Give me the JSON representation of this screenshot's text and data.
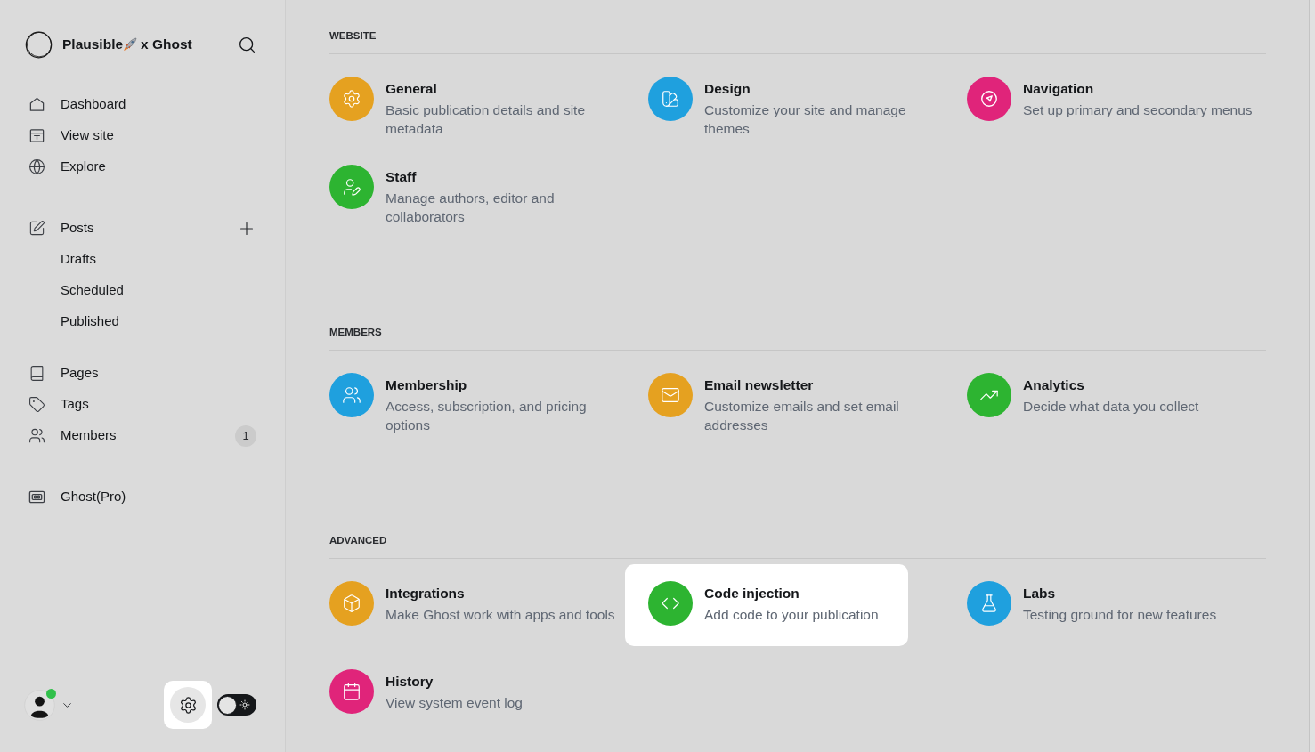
{
  "sidebar": {
    "brand": {
      "name": "Plausible",
      "suffix": "x Ghost"
    },
    "nav_groups": [
      {
        "items": [
          {
            "label": "Dashboard"
          },
          {
            "label": "View site"
          },
          {
            "label": "Explore"
          }
        ]
      },
      {
        "items": [
          {
            "label": "Posts",
            "children": [
              {
                "label": "Drafts"
              },
              {
                "label": "Scheduled"
              },
              {
                "label": "Published"
              }
            ]
          }
        ]
      },
      {
        "items": [
          {
            "label": "Pages"
          },
          {
            "label": "Tags"
          },
          {
            "label": "Members",
            "count": "1"
          }
        ]
      },
      {
        "items": [
          {
            "label": "Ghost(Pro)"
          }
        ]
      }
    ],
    "user": {
      "online": true
    },
    "settings_button": {
      "selected": true
    },
    "theme_toggle": {
      "on": false
    }
  },
  "sections": [
    {
      "heading": "WEBSITE",
      "items": [
        {
          "title": "General",
          "description": "Basic publication details and site metadata",
          "color": "#e5a120",
          "selected": false
        },
        {
          "title": "Design",
          "description": "Customize your site and manage themes",
          "color": "#1fa0de",
          "selected": false
        },
        {
          "title": "Navigation",
          "description": "Set up primary and secondary menus",
          "color": "#e0247a",
          "selected": false
        },
        {
          "title": "Staff",
          "description": "Manage authors, editor and collaborators",
          "color": "#2db431",
          "selected": false
        }
      ]
    },
    {
      "heading": "MEMBERS",
      "items": [
        {
          "title": "Membership",
          "description": "Access, subscription, and pricing options",
          "color": "#1fa0de",
          "selected": false
        },
        {
          "title": "Email newsletter",
          "description": "Customize emails and set email addresses",
          "color": "#e5a120",
          "selected": false
        },
        {
          "title": "Analytics",
          "description": "Decide what data you collect",
          "color": "#2db431",
          "selected": false
        }
      ]
    },
    {
      "heading": "ADVANCED",
      "items": [
        {
          "title": "Integrations",
          "description": "Make Ghost work with apps and tools",
          "color": "#e5a120",
          "selected": false
        },
        {
          "title": "Code injection",
          "description": "Add code to your publication",
          "color": "#2db431",
          "selected": true
        },
        {
          "title": "Labs",
          "description": "Testing ground for new features",
          "color": "#1fa0de",
          "selected": false
        },
        {
          "title": "History",
          "description": "View system event log",
          "color": "#e0247a",
          "selected": false
        }
      ]
    }
  ]
}
